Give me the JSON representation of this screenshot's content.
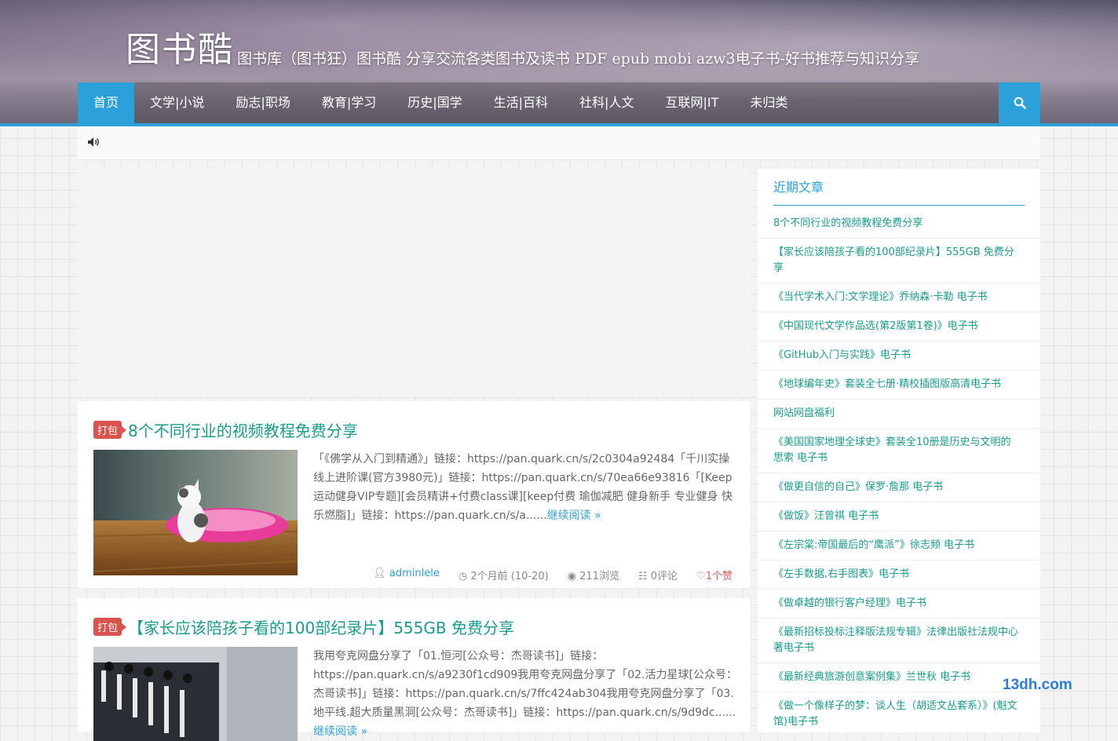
{
  "header": {
    "site_name": "图书酷",
    "tagline": "图书库（图书狂）图书酷 分享交流各类图书及读书 PDF epub mobi azw3电子书-好书推荐与知识分享"
  },
  "nav": {
    "items": [
      "首页",
      "文学|小说",
      "励志|职场",
      "教育|学习",
      "历史|国学",
      "生活|百科",
      "社科|人文",
      "互联网|IT",
      "未归类"
    ],
    "active": "首页",
    "search_icon": "search-icon",
    "accent_color": "#2ca0d8"
  },
  "notice": {
    "icon": "speaker-icon"
  },
  "posts": [
    {
      "badge": "打包",
      "title": "8个不同行业的视频教程免费分享",
      "excerpt": "「《佛学从入门到精通》」链接：https://pan.quark.cn/s/2c0304a92484「千川实操线上进阶课(官方3980元)」链接：https://pan.quark.cn/s/70ea66e93816「[Keep运动健身VIP专题][会员精讲+付费class课][keep付费 瑜伽减肥 健身新手 专业健身 快乐燃脂]」链接：https://pan.quark.cn/s/a......",
      "read_more": "继续阅读 »",
      "author": "adminlele",
      "date": "2个月前 (10-20)",
      "views": "211浏览",
      "comments": "0评论",
      "likes": "1个赞"
    },
    {
      "badge": "打包",
      "title": "【家长应该陪孩子看的100部纪录片】555GB 免费分享",
      "excerpt": "我用夸克网盘分享了「01.恒河[公众号：杰哥读书]」链接：https://pan.quark.cn/s/a9230f1cd909我用夸克网盘分享了「02.活力星球[公众号：杰哥读书]」链接：https://pan.quark.cn/s/7ffc424ab304我用夸克网盘分享了「03.地平线.超大质量黑洞[公众号：杰哥读书]」链接：https://pan.quark.cn/s/9d9dc......",
      "read_more": "继续阅读 »"
    }
  ],
  "sidebar": {
    "title": "近期文章",
    "items": [
      "8个不同行业的视频教程免费分享",
      "【家长应该陪孩子看的100部纪录片】555GB 免费分享",
      "《当代学术入门:文学理论》乔纳森·卡勒 电子书",
      "《中国现代文学作品选(第2版第1卷)》电子书",
      "《GitHub入门与实践》电子书",
      "《地球编年史》套装全七册·精校插图版高清电子书",
      "网站网盘福利",
      "《美国国家地理全球史》套装全10册是历史与文明的思索 电子书",
      "《做更自信的自己》保罗·詹那 电子书",
      "《做饭》汪曾祺 电子书",
      "《左宗棠:帝国最后的“鹰派”》徐志频 电子书",
      "《左手数据,右手图表》电子书",
      "《做卓越的银行客户经理》电子书",
      "《最新招标投标注释版法规专辑》法律出版社法规中心著电子书",
      "《最新经典旅游创意案例集》兰世秋 电子书",
      "《做一个像样子的梦：谈人生（胡适文丛套系）》(魁文馆)电子书"
    ]
  },
  "watermark": "13dh.com"
}
